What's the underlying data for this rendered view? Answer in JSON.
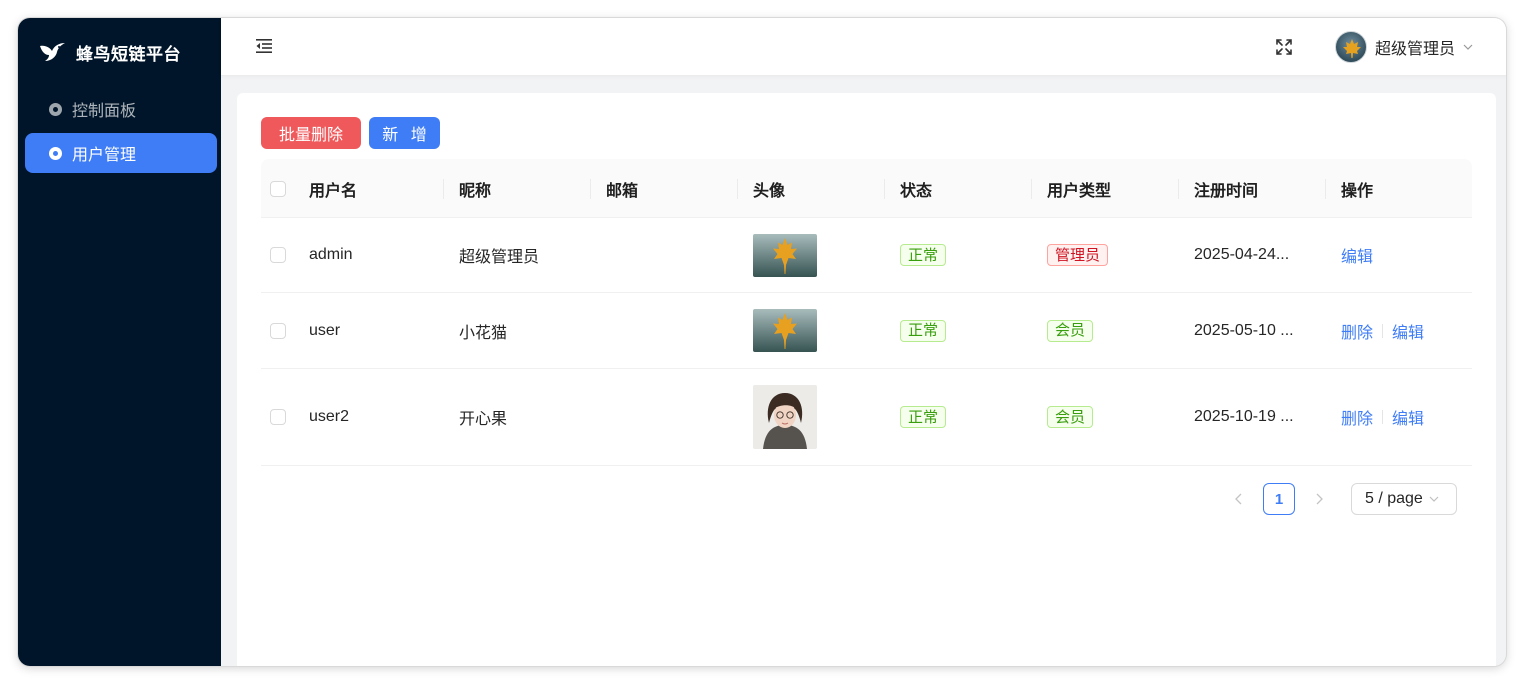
{
  "app": {
    "title": "蜂鸟短链平台"
  },
  "sidebar": {
    "items": [
      {
        "label": "控制面板",
        "icon": "dashboard-icon",
        "active": false
      },
      {
        "label": "用户管理",
        "icon": "user-icon",
        "active": true
      }
    ]
  },
  "header": {
    "user_name": "超级管理员",
    "icons": [
      "menu-fold-icon",
      "fullscreen-icon",
      "chevron-down-icon"
    ]
  },
  "toolbar": {
    "batch_delete_label": "批量删除",
    "add_label": "新 增"
  },
  "table": {
    "columns": [
      "用户名",
      "昵称",
      "邮箱",
      "头像",
      "状态",
      "用户类型",
      "注册时间",
      "操作"
    ],
    "rows": [
      {
        "username": "admin",
        "nickname": "超级管理员",
        "email": "",
        "avatar": "maple-leaf-image",
        "status": "正常",
        "type": "管理员",
        "registered": "2025-04-24...",
        "actions": [
          "编辑"
        ]
      },
      {
        "username": "user",
        "nickname": "小花猫",
        "email": "",
        "avatar": "maple-leaf-image",
        "status": "正常",
        "type": "会员",
        "registered": "2025-05-10 ...",
        "actions": [
          "删除",
          "编辑"
        ]
      },
      {
        "username": "user2",
        "nickname": "开心果",
        "email": "",
        "avatar": "girl-portrait-image",
        "status": "正常",
        "type": "会员",
        "registered": "2025-10-19 ...",
        "actions": [
          "删除",
          "编辑"
        ]
      }
    ]
  },
  "pagination": {
    "current_page": "1",
    "page_size_label": "5 / page"
  },
  "colors": {
    "sidebar_bg": "#001529",
    "primary": "#3f7df6",
    "danger": "#f0595b",
    "success_tag": "#389e0d",
    "admin_tag": "#cf1322"
  }
}
